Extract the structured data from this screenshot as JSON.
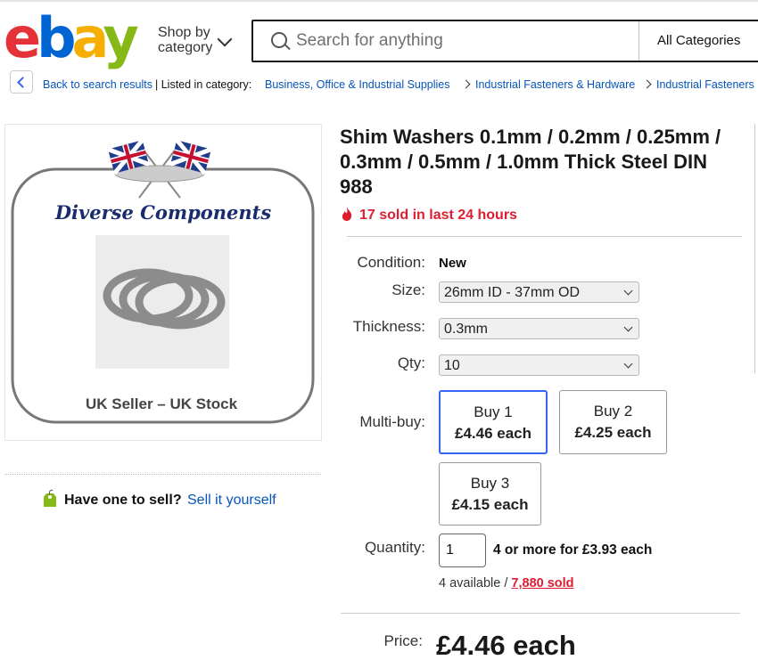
{
  "header": {
    "logo_letters": [
      "e",
      "b",
      "a",
      "y"
    ],
    "logo_colors": [
      "#e53238",
      "#0064d2",
      "#f5af02",
      "#86b817"
    ],
    "shop_by_line1": "Shop by",
    "shop_by_line2": "category",
    "search_placeholder": "Search for anything",
    "category_select": "All Categories"
  },
  "breadcrumb": {
    "back_label": "Back to search results",
    "listed_label": "| Listed in category:",
    "crumbs": [
      "Business, Office & Industrial Supplies",
      "Industrial Fasteners & Hardware",
      "Industrial Fasteners"
    ]
  },
  "image": {
    "brand_text": "Diverse Components",
    "footer_text": "UK Seller – UK Stock"
  },
  "sell": {
    "question": "Have one to sell?",
    "link": "Sell it yourself"
  },
  "product": {
    "title": "Shim Washers 0.1mm / 0.2mm / 0.25mm / 0.3mm / 0.5mm / 1.0mm Thick Steel DIN 988",
    "sold_recent": "17 sold in last 24 hours",
    "condition_label": "Condition:",
    "condition_value": "New",
    "size_label": "Size:",
    "size_value": "26mm ID - 37mm OD",
    "thickness_label": "Thickness:",
    "thickness_value": "0.3mm",
    "qty_label": "Qty:",
    "qty_value": "10",
    "multibuy_label": "Multi-buy:",
    "multibuy": [
      {
        "line1": "Buy 1",
        "line2": "£4.46 each"
      },
      {
        "line1": "Buy 2",
        "line2": "£4.25 each"
      },
      {
        "line1": "Buy 3",
        "line2": "£4.15 each"
      }
    ],
    "quantity_label": "Quantity:",
    "quantity_value": "1",
    "quantity_note": "4 or more for £3.93 each",
    "available": "4 available /",
    "sold_total": "7,880 sold",
    "price_label": "Price:",
    "price_value": "£4.46 each"
  },
  "colors": {
    "link": "#0654ba",
    "accent_blue": "#3665f3",
    "alert_red": "#dd1e31"
  }
}
